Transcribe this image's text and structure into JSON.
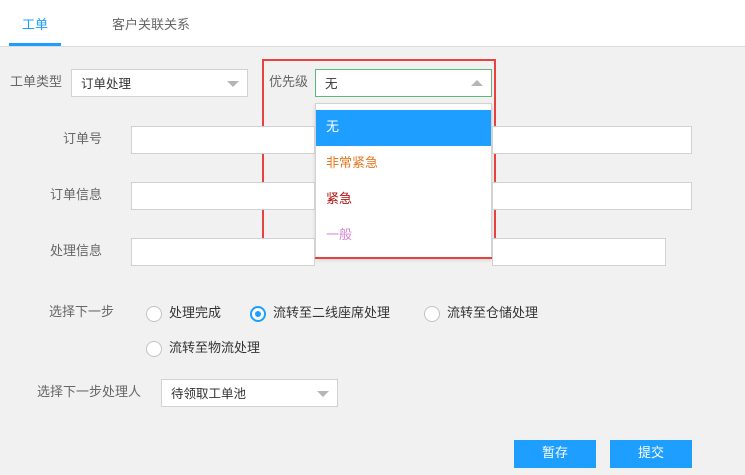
{
  "tabs": [
    {
      "label": "工单"
    },
    {
      "label": "客户关联关系"
    }
  ],
  "form": {
    "ticket_type": {
      "label": "工单类型",
      "value": "订单处理"
    },
    "priority": {
      "label": "优先级",
      "value": "无",
      "options": [
        {
          "label": "无",
          "color": "#ffffff",
          "selected": true
        },
        {
          "label": "非常紧急",
          "color": "#e8761e",
          "selected": false
        },
        {
          "label": "紧急",
          "color": "#b21010",
          "selected": false
        },
        {
          "label": "一般",
          "color": "#d987d6",
          "selected": false
        }
      ]
    },
    "order_no": {
      "label": "订单号",
      "value": ""
    },
    "order_info": {
      "label": "订单信息",
      "value": ""
    },
    "process_info": {
      "label": "处理信息",
      "value": ""
    },
    "next_step": {
      "label": "选择下一步",
      "options": [
        {
          "label": "处理完成",
          "checked": false
        },
        {
          "label": "流转至二线座席处理",
          "checked": true
        },
        {
          "label": "流转至仓储处理",
          "checked": false
        },
        {
          "label": "流转至物流处理",
          "checked": false
        }
      ]
    },
    "next_handler": {
      "label": "选择下一步处理人",
      "value": "待领取工单池"
    }
  },
  "buttons": {
    "save": "暂存",
    "submit": "提交"
  },
  "colors": {
    "accent": "#1e9fff",
    "selected_option_bg": "#1e9fff",
    "highlight_border": "#e8413f"
  }
}
